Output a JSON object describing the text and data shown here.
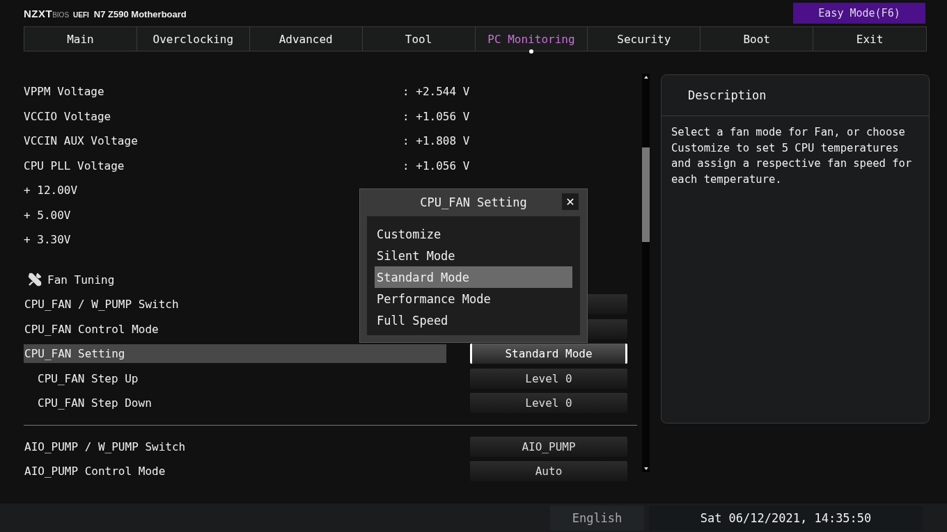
{
  "header": {
    "brand": "NZXT",
    "brand_suffix": "BIOS",
    "firmware": "UEFI",
    "board": "N7 Z590 Motherboard",
    "mode_button": "Easy Mode(F6)"
  },
  "tabs": [
    {
      "label": "Main",
      "selected": false
    },
    {
      "label": "Overclocking",
      "selected": false
    },
    {
      "label": "Advanced",
      "selected": false
    },
    {
      "label": "Tool",
      "selected": false
    },
    {
      "label": "PC Monitoring",
      "selected": true
    },
    {
      "label": "Security",
      "selected": false
    },
    {
      "label": "Boot",
      "selected": false
    },
    {
      "label": "Exit",
      "selected": false
    }
  ],
  "items": [
    {
      "kind": "reading",
      "label": "VPPM Voltage",
      "value": ": +2.544 V"
    },
    {
      "kind": "reading",
      "label": "VCCIO Voltage",
      "value": ": +1.056 V"
    },
    {
      "kind": "reading",
      "label": "VCCIN AUX Voltage",
      "value": ": +1.808 V"
    },
    {
      "kind": "reading",
      "label": "CPU PLL Voltage",
      "value": ": +1.056 V"
    },
    {
      "kind": "reading",
      "label": "+ 12.00V"
    },
    {
      "kind": "reading",
      "label": "+ 5.00V"
    },
    {
      "kind": "reading",
      "label": "+ 3.30V"
    },
    {
      "kind": "section",
      "label": "Fan Tuning"
    },
    {
      "kind": "setting",
      "label": "CPU_FAN / W_PUMP Switch",
      "selected": false
    },
    {
      "kind": "setting",
      "label": "CPU_FAN Control Mode",
      "selected": false
    },
    {
      "kind": "setting",
      "label": "CPU_FAN Setting",
      "value": "Standard Mode",
      "selected": true,
      "children": [
        {
          "kind": "setting",
          "label": "CPU_FAN Step Up",
          "value": "Level 0",
          "selected": false
        },
        {
          "kind": "setting",
          "label": "CPU_FAN Step Down",
          "value": "Level 0",
          "selected": false
        }
      ]
    },
    {
      "kind": "divider"
    },
    {
      "kind": "setting",
      "label": "AIO_PUMP / W_PUMP Switch",
      "value": "AIO_PUMP",
      "selected": false
    },
    {
      "kind": "setting",
      "label": "AIO_PUMP Control Mode",
      "value": "Auto",
      "selected": false
    }
  ],
  "description": {
    "title": "Description",
    "text": "Select a fan mode for Fan, or choose Customize to set 5 CPU temperatures and assign a respective fan speed for each temperature."
  },
  "dialog": {
    "title": "CPU_FAN Setting",
    "close": "✕",
    "options": [
      {
        "label": "Customize",
        "selected": false
      },
      {
        "label": "Silent Mode",
        "selected": false
      },
      {
        "label": "Standard Mode",
        "selected": true
      },
      {
        "label": "Performance Mode",
        "selected": false
      },
      {
        "label": "Full Speed",
        "selected": false
      }
    ]
  },
  "status_bar": {
    "language": "English",
    "datetime": "Sat 06/12/2021, 14:35:50"
  }
}
